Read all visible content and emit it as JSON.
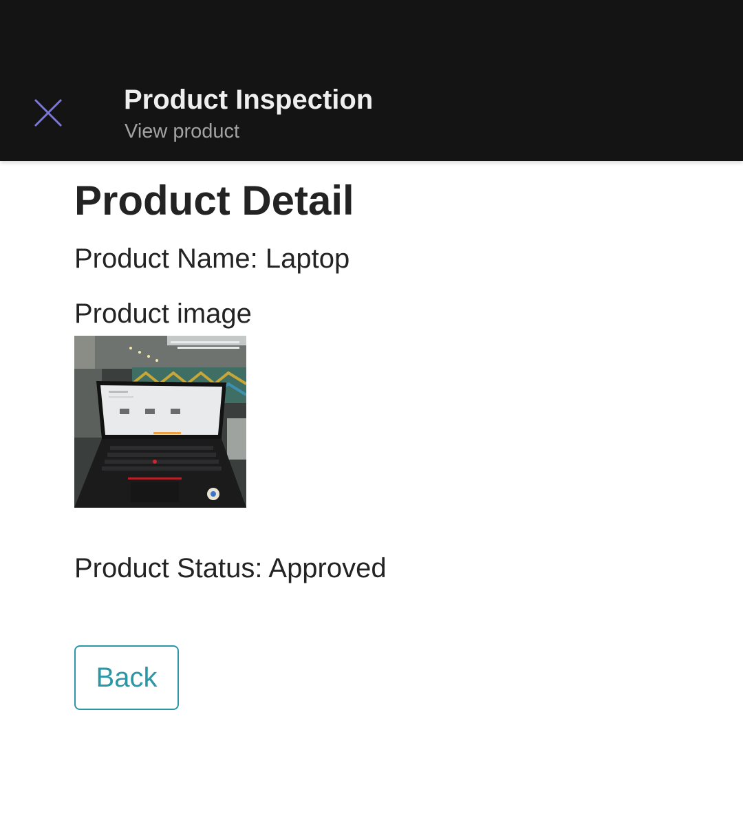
{
  "header": {
    "title": "Product Inspection",
    "subtitle": "View product",
    "close_icon": "close-icon",
    "close_icon_color": "#7b78d8",
    "background": "#141414"
  },
  "main": {
    "page_title": "Product Detail",
    "product_name_line": "Product Name: Laptop",
    "product_image_label": "Product image",
    "product_status_line": "Product Status: Approved",
    "back_button_label": "Back",
    "accent_color": "#2a96a6"
  }
}
